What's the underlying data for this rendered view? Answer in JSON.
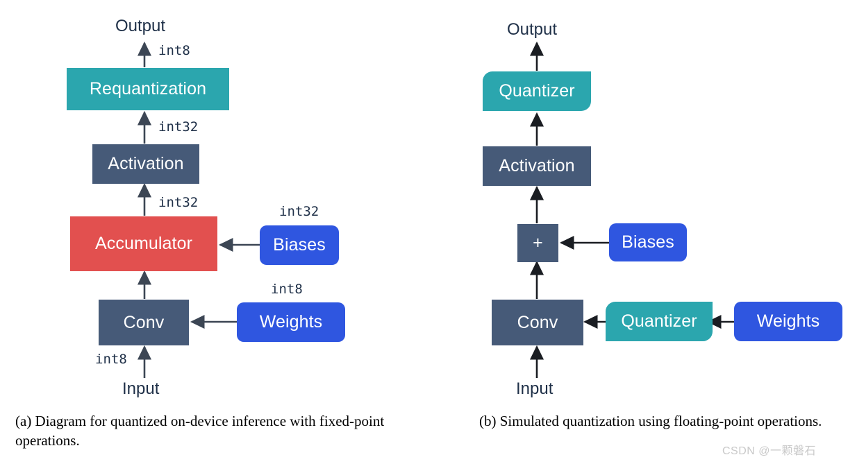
{
  "figure": {
    "background": "#ffffff",
    "colors": {
      "teal": "#2ba6ae",
      "slate": "#465a78",
      "red": "#e2504f",
      "blue": "#2f56e0",
      "text_dark": "#1f3048",
      "arrow": "#3c4654",
      "watermark": "#c9c9c9"
    }
  },
  "panel_a": {
    "id": "a",
    "caption": "(a) Diagram for quantized on-device inference with fixed-point operations.",
    "nodes": {
      "output": "Output",
      "requantization": "Requantization",
      "activation": "Activation",
      "accumulator": "Accumulator",
      "biases": "Biases",
      "conv": "Conv",
      "weights": "Weights",
      "input": "Input"
    },
    "edge_labels": {
      "output_dtype": "int8",
      "requant_in_dtype": "int32",
      "activation_in_dtype": "int32",
      "biases_dtype": "int32",
      "weights_dtype": "int8",
      "input_dtype": "int8"
    }
  },
  "panel_b": {
    "id": "b",
    "caption": "(b) Simulated quantization using floating-point operations.",
    "nodes": {
      "output": "Output",
      "quantizer_act": "Quantizer",
      "activation": "Activation",
      "adder": "+",
      "biases": "Biases",
      "conv": "Conv",
      "quantizer_weights": "Quantizer",
      "weights": "Weights",
      "input": "Input"
    }
  },
  "watermark": "CSDN @一颗磐石"
}
